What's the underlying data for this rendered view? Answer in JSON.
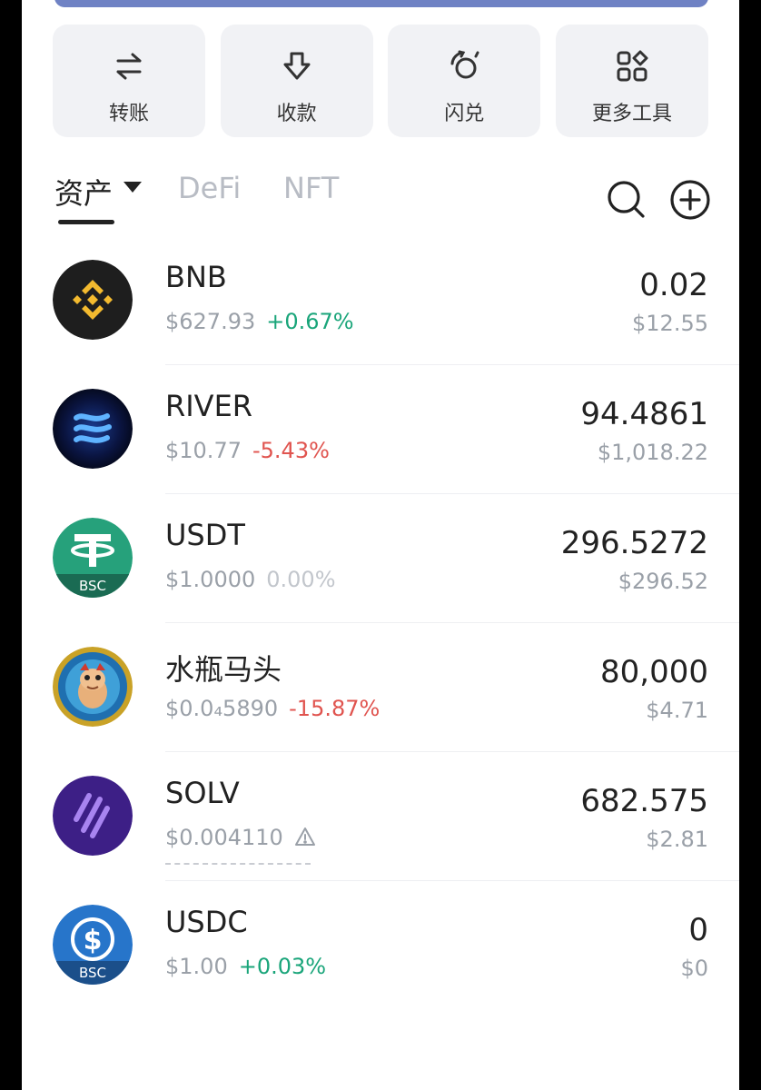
{
  "actions": [
    {
      "label": "转账",
      "icon": "transfer-icon"
    },
    {
      "label": "收款",
      "icon": "receive-icon"
    },
    {
      "label": "闪兑",
      "icon": "swap-icon"
    },
    {
      "label": "更多工具",
      "icon": "more-tools-icon"
    }
  ],
  "tabs": {
    "assets": "资产",
    "defi": "DeFi",
    "nft": "NFT"
  },
  "tokens": [
    {
      "symbol": "BNB",
      "price": "$627.93",
      "change": "+0.67%",
      "change_dir": "up",
      "amount": "0.02",
      "value": "$12.55"
    },
    {
      "symbol": "RIVER",
      "price": "$10.77",
      "change": "-5.43%",
      "change_dir": "down",
      "amount": "94.4861",
      "value": "$1,018.22"
    },
    {
      "symbol": "USDT",
      "price": "$1.0000",
      "change": "0.00%",
      "change_dir": "flat",
      "amount": "296.5272",
      "value": "$296.52",
      "chain_badge": "BSC"
    },
    {
      "symbol": "水瓶马头",
      "price": "$0.0₄5890",
      "change": "-15.87%",
      "change_dir": "down",
      "amount": "80,000",
      "value": "$4.71"
    },
    {
      "symbol": "SOLV",
      "price": "$0.004110",
      "change": "",
      "change_dir": "warning",
      "amount": "682.575",
      "value": "$2.81"
    },
    {
      "symbol": "USDC",
      "price": "$1.00",
      "change": "+0.03%",
      "change_dir": "up",
      "amount": "0",
      "value": "$0",
      "chain_badge": "BSC"
    }
  ],
  "colors": {
    "up": "#1aa57a",
    "down": "#e0544f",
    "accent_bar": "#6f82c4"
  }
}
